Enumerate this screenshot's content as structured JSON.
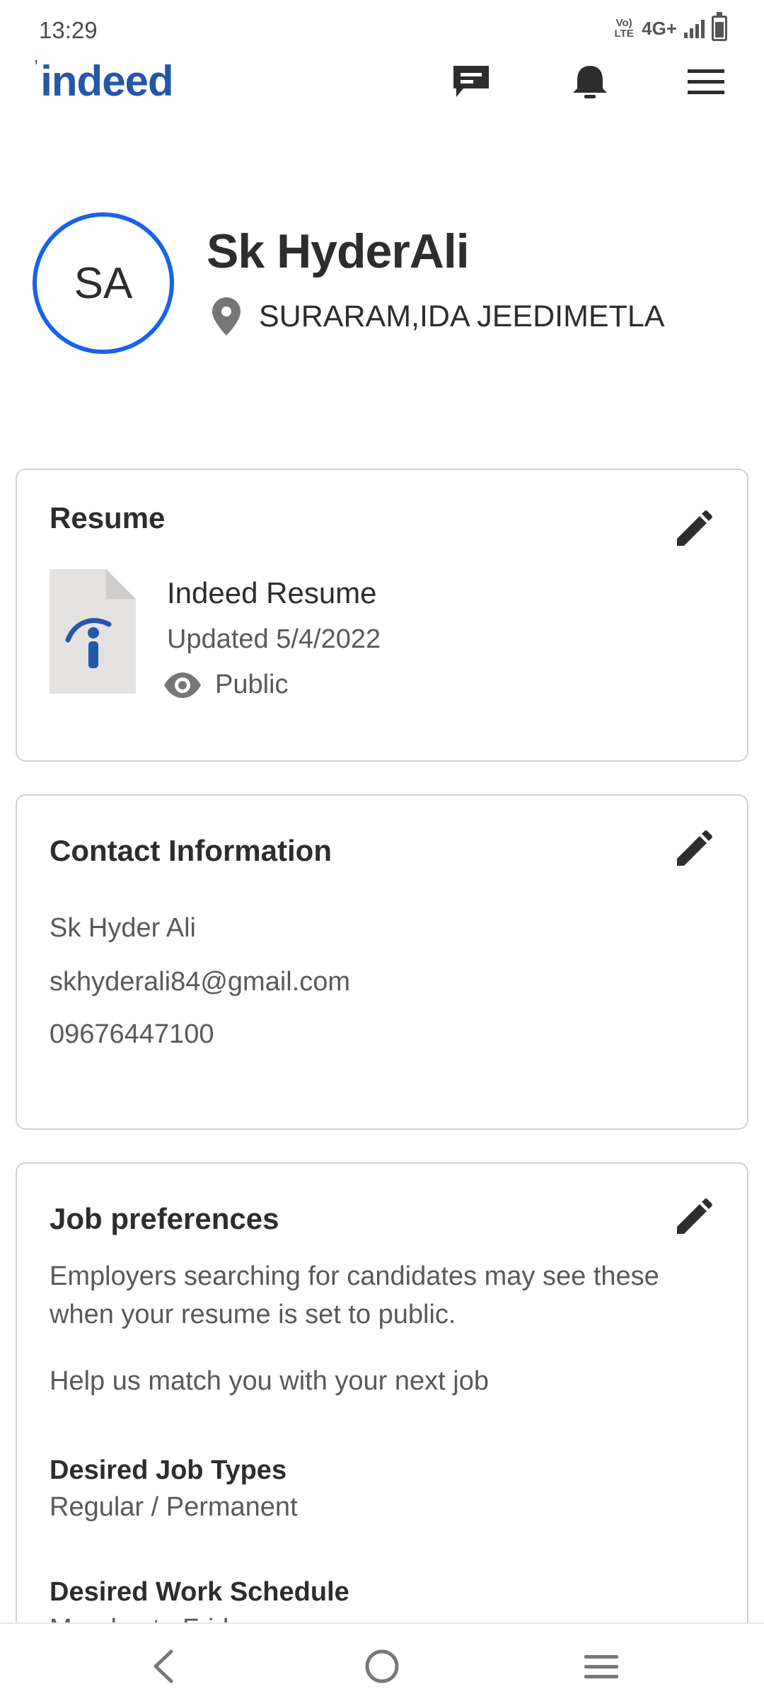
{
  "status_bar": {
    "time": "13:29",
    "volte": "Vo) LTE",
    "network": "4G+"
  },
  "header": {
    "logo_text": "indeed",
    "icons": [
      "messages-icon",
      "notifications-icon",
      "menu-icon"
    ]
  },
  "profile": {
    "initials": "SA",
    "name": "Sk HyderAli",
    "location": "SURARAM,IDA JEEDIMETLA"
  },
  "resume_card": {
    "title": "Resume",
    "file_name": "Indeed Resume",
    "updated": "Updated 5/4/2022",
    "visibility": "Public"
  },
  "contact_card": {
    "title": "Contact Information",
    "name": "Sk Hyder Ali",
    "email": "skhyderali84@gmail.com",
    "phone": "09676447100"
  },
  "job_preferences": {
    "title": "Job preferences",
    "description": "Employers searching for candidates may see these when your resume is set to public.",
    "help_text": "Help us match you with your next job",
    "job_types_label": "Desired Job Types",
    "job_types_value": "Regular / Permanent",
    "schedule_label": "Desired Work Schedule",
    "schedule_value": "Monday to Friday"
  },
  "colors": {
    "brand_blue": "#2557a7",
    "avatar_ring": "#1a62e8",
    "text_dark": "#2d2d2d",
    "text_muted": "#595959",
    "card_border": "#d4d2d0"
  }
}
